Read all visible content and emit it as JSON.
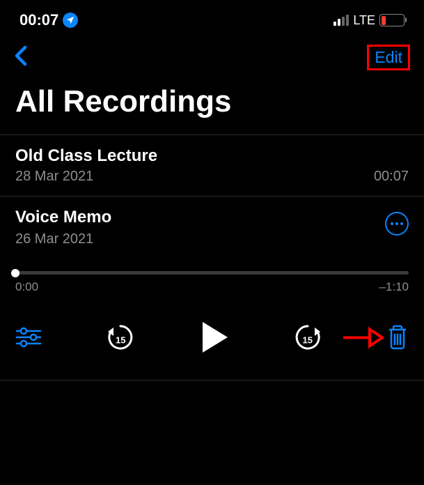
{
  "statusBar": {
    "time": "00:07",
    "network": "LTE"
  },
  "nav": {
    "editLabel": "Edit"
  },
  "title": "All Recordings",
  "recordings": [
    {
      "title": "Old Class Lecture",
      "date": "28 Mar 2021",
      "duration": "00:07"
    },
    {
      "title": "Voice Memo",
      "date": "26 Mar 2021",
      "duration": "1:10"
    }
  ],
  "player": {
    "elapsed": "0:00",
    "remaining": "–1:10",
    "skipSeconds": "15"
  }
}
